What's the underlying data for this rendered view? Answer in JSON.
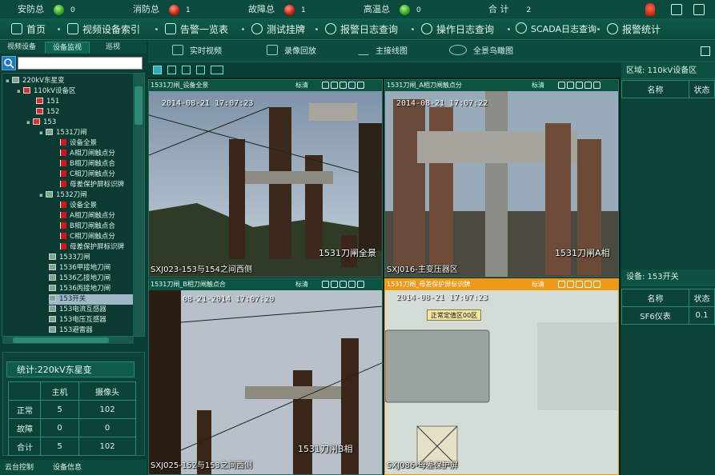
{
  "status": {
    "items": [
      {
        "label": "安防总",
        "count": "0",
        "color": "green"
      },
      {
        "label": "消防总",
        "count": "1",
        "color": "red"
      },
      {
        "label": "故障总",
        "count": "1",
        "color": "red"
      },
      {
        "label": "高温总",
        "count": "0",
        "color": "green"
      },
      {
        "label": "合  计",
        "count": "2"
      }
    ]
  },
  "nav": {
    "home": "首页",
    "video_index": "视频设备索引",
    "alarm_list": "告警一览表",
    "test_link": "测试挂牌",
    "alarm_log": "报警日志查询",
    "op_log": "操作日志查询",
    "scada_log": "SCADA日志查询",
    "alarm_stats": "报警统计"
  },
  "left_tabs": [
    "视频设备",
    "设备监视",
    "巡视"
  ],
  "tree": {
    "root": "220kV东星变",
    "area": "110kV设备区",
    "nodes": [
      "151",
      "152",
      "153",
      "1531刀闸",
      "设备全景",
      "A相刀闸触点分",
      "B相刀闸触点合",
      "C相刀闸触点分",
      "母差保护屏标识牌",
      "1532刀闸",
      "设备全景",
      "A相刀闸触点分",
      "B相刀闸触点合",
      "C相刀闸触点分",
      "母差保护屏标识牌",
      "1533刀闸",
      "1536甲接地刀闸",
      "1536乙接地刀闸",
      "1536丙接地刀闸",
      "153开关",
      "153电流互感器",
      "153电压互感器",
      "153避雷器"
    ]
  },
  "stats": {
    "title": "统计:220kV东星变",
    "headers": [
      "",
      "主机",
      "摄像头"
    ],
    "rows": [
      [
        "正常",
        "5",
        "102"
      ],
      [
        "故障",
        "0",
        "0"
      ],
      [
        "合计",
        "5",
        "102"
      ]
    ]
  },
  "bottom_tabs": [
    "云台控制",
    "设备信息"
  ],
  "sub_toolbar": {
    "realtime": "实时视频",
    "playback": "录像回放",
    "wiring": "主接线图",
    "panorama": "全景鸟瞰图"
  },
  "cams": [
    {
      "title": "1531刀闸_设备全景",
      "quality": "标清",
      "time": "2014-08-21 17:07:23",
      "location": "SXJ023-153与154之间西侧",
      "name": "1531刀闸全景"
    },
    {
      "title": "1531刀闸_A相刀闸触点分",
      "quality": "标清",
      "time": "2014-08-21 17:07:22",
      "location": "SXJ016-主变压器区",
      "name": "1531刀闸A相"
    },
    {
      "title": "1531刀闸_B相刀闸触点合",
      "quality": "标清",
      "time": "08-21-2014 17:07:20",
      "location": "SXJ025-152与153之间西侧",
      "name": "1531刀闸B相"
    },
    {
      "title": "1531刀闸_母差保护屏标识牌",
      "quality": "标清",
      "time": "2014-08-21 17:07:23",
      "location": "SXJ086-母差保护屏",
      "name": "正常定值区00区"
    }
  ],
  "right_panel": {
    "area_title": "区域: 110kV设备区",
    "area_headers": [
      "名称",
      "状态"
    ],
    "device_title": "设备: 153开关",
    "device_headers": [
      "名称",
      "状态"
    ],
    "device_rows": [
      [
        "SF6仪表",
        "0.1"
      ]
    ]
  },
  "colors": {
    "bg": "#0a3d33",
    "accent": "#ed9a18",
    "alarm_red": "#d81d10",
    "ok_green": "#2da31d"
  }
}
